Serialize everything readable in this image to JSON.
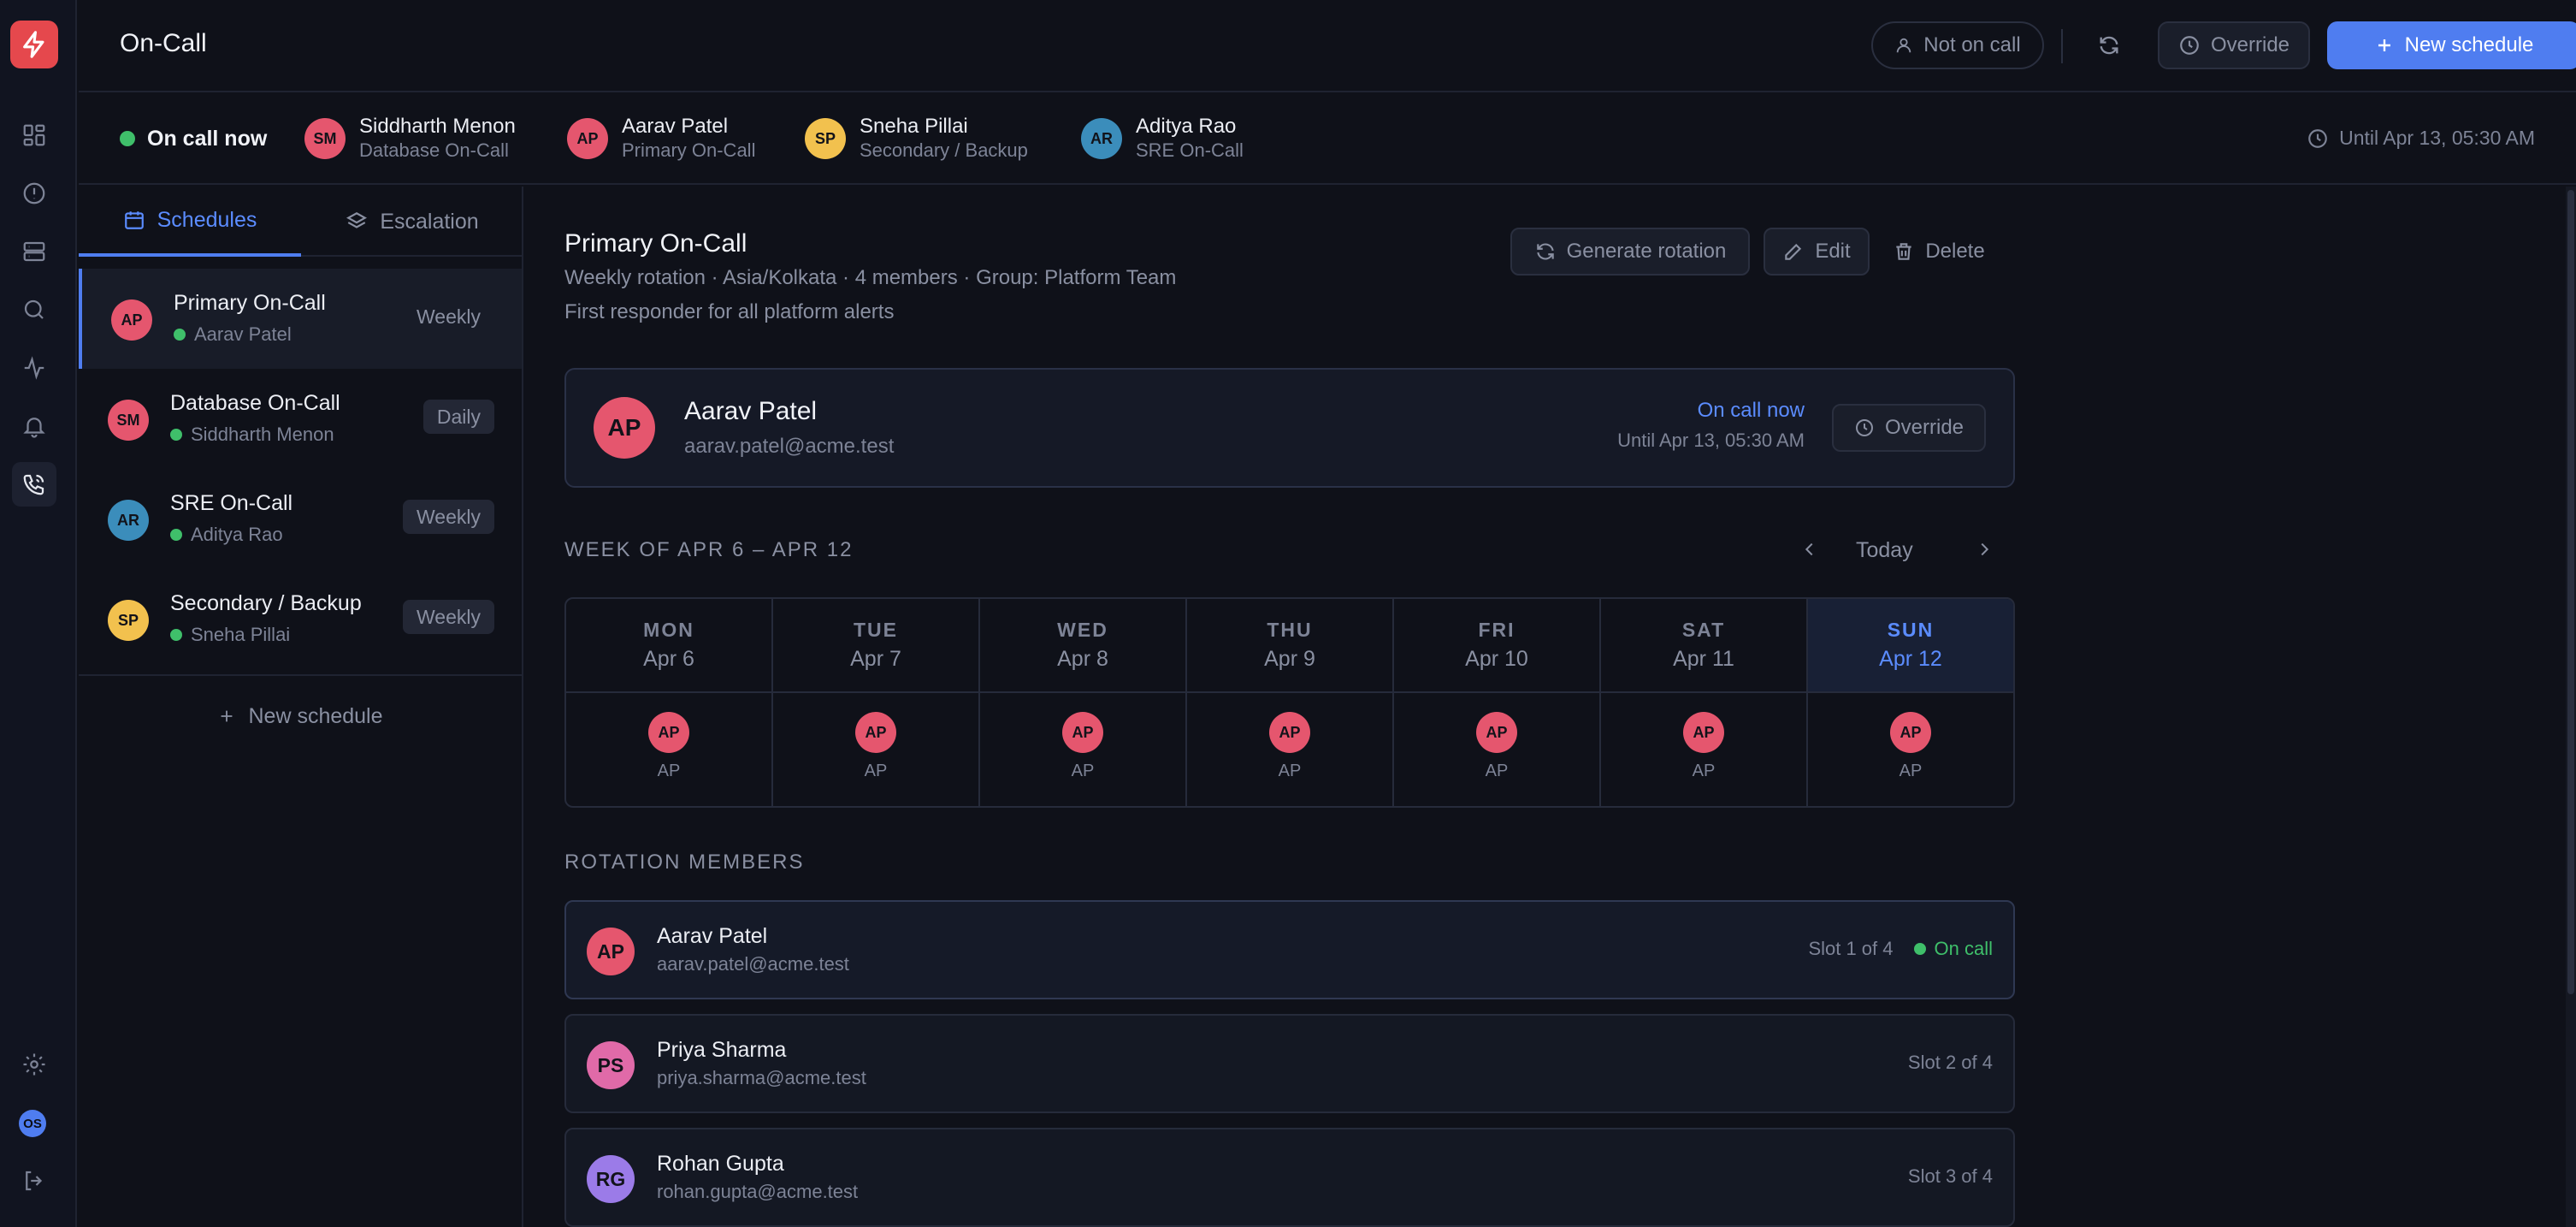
{
  "header": {
    "title": "On-Call",
    "not_on_call": "Not on call",
    "override": "Override",
    "new_schedule": "New schedule"
  },
  "strip": {
    "now_label": "On call now",
    "people": [
      {
        "initials": "SM",
        "name": "Siddharth Menon",
        "schedule": "Database On-Call",
        "color": "#e5566e"
      },
      {
        "initials": "AP",
        "name": "Aarav Patel",
        "schedule": "Primary On-Call",
        "color": "#e5566e"
      },
      {
        "initials": "SP",
        "name": "Sneha Pillai",
        "schedule": "Secondary / Backup",
        "color": "#f2c14e"
      },
      {
        "initials": "AR",
        "name": "Aditya Rao",
        "schedule": "SRE On-Call",
        "color": "#3b8dbb"
      }
    ],
    "until": "Until Apr 13, 05:30 AM"
  },
  "sidebar": {
    "tabs": [
      {
        "label": "Schedules"
      },
      {
        "label": "Escalation"
      }
    ],
    "schedules": [
      {
        "initials": "AP",
        "name": "Primary On-Call",
        "oncall": "Aarav Patel",
        "freq": "Weekly",
        "color": "#e5566e"
      },
      {
        "initials": "SM",
        "name": "Database On-Call",
        "oncall": "Siddharth Menon",
        "freq": "Daily",
        "color": "#e5566e"
      },
      {
        "initials": "AR",
        "name": "SRE On-Call",
        "oncall": "Aditya Rao",
        "freq": "Weekly",
        "color": "#3b8dbb"
      },
      {
        "initials": "SP",
        "name": "Secondary / Backup",
        "oncall": "Sneha Pillai",
        "freq": "Weekly",
        "color": "#f2c14e"
      }
    ],
    "new_schedule": "New schedule"
  },
  "main": {
    "title": "Primary On-Call",
    "meta": "Weekly rotation · Asia/Kolkata · 4 members · Group: Platform Team",
    "description": "First responder for all platform alerts",
    "actions": {
      "generate": "Generate rotation",
      "edit": "Edit",
      "delete": "Delete"
    },
    "current": {
      "initials": "AP",
      "name": "Aarav Patel",
      "email": "aarav.patel@acme.test",
      "status": "On call now",
      "until": "Until Apr 13, 05:30 AM",
      "override": "Override",
      "color": "#e5566e"
    },
    "week": {
      "label": "WEEK OF APR 6 – APR 12",
      "today": "Today",
      "days": [
        {
          "name": "MON",
          "date": "Apr 6",
          "initials": "AP"
        },
        {
          "name": "TUE",
          "date": "Apr 7",
          "initials": "AP"
        },
        {
          "name": "WED",
          "date": "Apr 8",
          "initials": "AP"
        },
        {
          "name": "THU",
          "date": "Apr 9",
          "initials": "AP"
        },
        {
          "name": "FRI",
          "date": "Apr 10",
          "initials": "AP"
        },
        {
          "name": "SAT",
          "date": "Apr 11",
          "initials": "AP"
        },
        {
          "name": "SUN",
          "date": "Apr 12",
          "initials": "AP"
        }
      ]
    },
    "members_label": "ROTATION MEMBERS",
    "members": [
      {
        "initials": "AP",
        "name": "Aarav Patel",
        "email": "aarav.patel@acme.test",
        "slot": "Slot 1 of 4",
        "status": "On call",
        "color": "#e5566e"
      },
      {
        "initials": "PS",
        "name": "Priya Sharma",
        "email": "priya.sharma@acme.test",
        "slot": "Slot 2 of 4",
        "status": "",
        "color": "#e06aa8"
      },
      {
        "initials": "RG",
        "name": "Rohan Gupta",
        "email": "rohan.gupta@acme.test",
        "slot": "Slot 3 of 4",
        "status": "",
        "color": "#9b7be8"
      }
    ]
  },
  "rail": {
    "avatar_initials": "OS"
  }
}
